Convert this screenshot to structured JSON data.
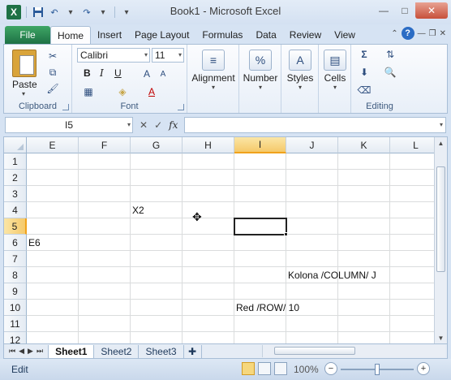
{
  "window": {
    "title": "Book1  -  Microsoft Excel",
    "minimize": "—",
    "maximize": "□",
    "close": "✕"
  },
  "qat": {
    "app_icon": "X",
    "save": "💾",
    "undo": "↶",
    "redo": "↷",
    "customize": "▾"
  },
  "tabs": {
    "file": "File",
    "items": [
      "Home",
      "Insert",
      "Page Layout",
      "Formulas",
      "Data",
      "Review",
      "View"
    ],
    "help": "?"
  },
  "ribbon": {
    "clipboard": {
      "label": "Clipboard",
      "paste": "Paste"
    },
    "font": {
      "label": "Font",
      "name": "Calibri",
      "size": "11",
      "bold": "B",
      "italic": "I",
      "underline": "U"
    },
    "alignment": {
      "label": "Alignment"
    },
    "number": {
      "label": "Number",
      "icon": "%"
    },
    "styles": {
      "label": "Styles"
    },
    "cells": {
      "label": "Cells"
    },
    "editing": {
      "label": "Editing",
      "sum": "Σ"
    }
  },
  "formula_bar": {
    "name_box": "I5",
    "cancel": "✕",
    "enter": "✓",
    "fx": "fx",
    "value": ""
  },
  "sheet": {
    "columns": [
      "E",
      "F",
      "G",
      "H",
      "I",
      "J",
      "K",
      "L"
    ],
    "selected_column": "I",
    "rows": [
      "1",
      "2",
      "3",
      "4",
      "5",
      "6",
      "7",
      "8",
      "9",
      "10",
      "11",
      "12"
    ],
    "selected_row": "5",
    "cells": {
      "G4": "X2",
      "E6": "E6",
      "J8": "Kolona /COLUMN/ J",
      "I10": "Red /ROW/ 10"
    },
    "active_cell": "I5"
  },
  "sheet_tabs": {
    "items": [
      "Sheet1",
      "Sheet2",
      "Sheet3"
    ],
    "active": "Sheet1"
  },
  "status": {
    "mode": "Edit",
    "zoom": "100%"
  }
}
